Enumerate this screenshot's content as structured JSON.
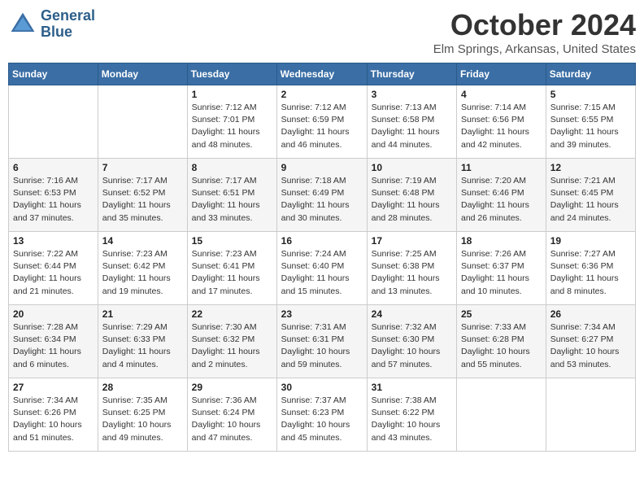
{
  "logo": {
    "line1": "General",
    "line2": "Blue"
  },
  "title": "October 2024",
  "location": "Elm Springs, Arkansas, United States",
  "days_of_week": [
    "Sunday",
    "Monday",
    "Tuesday",
    "Wednesday",
    "Thursday",
    "Friday",
    "Saturday"
  ],
  "weeks": [
    [
      {
        "day": "",
        "info": ""
      },
      {
        "day": "",
        "info": ""
      },
      {
        "day": "1",
        "sunrise": "7:12 AM",
        "sunset": "7:01 PM",
        "daylight": "11 hours and 48 minutes."
      },
      {
        "day": "2",
        "sunrise": "7:12 AM",
        "sunset": "6:59 PM",
        "daylight": "11 hours and 46 minutes."
      },
      {
        "day": "3",
        "sunrise": "7:13 AM",
        "sunset": "6:58 PM",
        "daylight": "11 hours and 44 minutes."
      },
      {
        "day": "4",
        "sunrise": "7:14 AM",
        "sunset": "6:56 PM",
        "daylight": "11 hours and 42 minutes."
      },
      {
        "day": "5",
        "sunrise": "7:15 AM",
        "sunset": "6:55 PM",
        "daylight": "11 hours and 39 minutes."
      }
    ],
    [
      {
        "day": "6",
        "sunrise": "7:16 AM",
        "sunset": "6:53 PM",
        "daylight": "11 hours and 37 minutes."
      },
      {
        "day": "7",
        "sunrise": "7:17 AM",
        "sunset": "6:52 PM",
        "daylight": "11 hours and 35 minutes."
      },
      {
        "day": "8",
        "sunrise": "7:17 AM",
        "sunset": "6:51 PM",
        "daylight": "11 hours and 33 minutes."
      },
      {
        "day": "9",
        "sunrise": "7:18 AM",
        "sunset": "6:49 PM",
        "daylight": "11 hours and 30 minutes."
      },
      {
        "day": "10",
        "sunrise": "7:19 AM",
        "sunset": "6:48 PM",
        "daylight": "11 hours and 28 minutes."
      },
      {
        "day": "11",
        "sunrise": "7:20 AM",
        "sunset": "6:46 PM",
        "daylight": "11 hours and 26 minutes."
      },
      {
        "day": "12",
        "sunrise": "7:21 AM",
        "sunset": "6:45 PM",
        "daylight": "11 hours and 24 minutes."
      }
    ],
    [
      {
        "day": "13",
        "sunrise": "7:22 AM",
        "sunset": "6:44 PM",
        "daylight": "11 hours and 21 minutes."
      },
      {
        "day": "14",
        "sunrise": "7:23 AM",
        "sunset": "6:42 PM",
        "daylight": "11 hours and 19 minutes."
      },
      {
        "day": "15",
        "sunrise": "7:23 AM",
        "sunset": "6:41 PM",
        "daylight": "11 hours and 17 minutes."
      },
      {
        "day": "16",
        "sunrise": "7:24 AM",
        "sunset": "6:40 PM",
        "daylight": "11 hours and 15 minutes."
      },
      {
        "day": "17",
        "sunrise": "7:25 AM",
        "sunset": "6:38 PM",
        "daylight": "11 hours and 13 minutes."
      },
      {
        "day": "18",
        "sunrise": "7:26 AM",
        "sunset": "6:37 PM",
        "daylight": "11 hours and 10 minutes."
      },
      {
        "day": "19",
        "sunrise": "7:27 AM",
        "sunset": "6:36 PM",
        "daylight": "11 hours and 8 minutes."
      }
    ],
    [
      {
        "day": "20",
        "sunrise": "7:28 AM",
        "sunset": "6:34 PM",
        "daylight": "11 hours and 6 minutes."
      },
      {
        "day": "21",
        "sunrise": "7:29 AM",
        "sunset": "6:33 PM",
        "daylight": "11 hours and 4 minutes."
      },
      {
        "day": "22",
        "sunrise": "7:30 AM",
        "sunset": "6:32 PM",
        "daylight": "11 hours and 2 minutes."
      },
      {
        "day": "23",
        "sunrise": "7:31 AM",
        "sunset": "6:31 PM",
        "daylight": "10 hours and 59 minutes."
      },
      {
        "day": "24",
        "sunrise": "7:32 AM",
        "sunset": "6:30 PM",
        "daylight": "10 hours and 57 minutes."
      },
      {
        "day": "25",
        "sunrise": "7:33 AM",
        "sunset": "6:28 PM",
        "daylight": "10 hours and 55 minutes."
      },
      {
        "day": "26",
        "sunrise": "7:34 AM",
        "sunset": "6:27 PM",
        "daylight": "10 hours and 53 minutes."
      }
    ],
    [
      {
        "day": "27",
        "sunrise": "7:34 AM",
        "sunset": "6:26 PM",
        "daylight": "10 hours and 51 minutes."
      },
      {
        "day": "28",
        "sunrise": "7:35 AM",
        "sunset": "6:25 PM",
        "daylight": "10 hours and 49 minutes."
      },
      {
        "day": "29",
        "sunrise": "7:36 AM",
        "sunset": "6:24 PM",
        "daylight": "10 hours and 47 minutes."
      },
      {
        "day": "30",
        "sunrise": "7:37 AM",
        "sunset": "6:23 PM",
        "daylight": "10 hours and 45 minutes."
      },
      {
        "day": "31",
        "sunrise": "7:38 AM",
        "sunset": "6:22 PM",
        "daylight": "10 hours and 43 minutes."
      },
      {
        "day": "",
        "info": ""
      },
      {
        "day": "",
        "info": ""
      }
    ]
  ]
}
